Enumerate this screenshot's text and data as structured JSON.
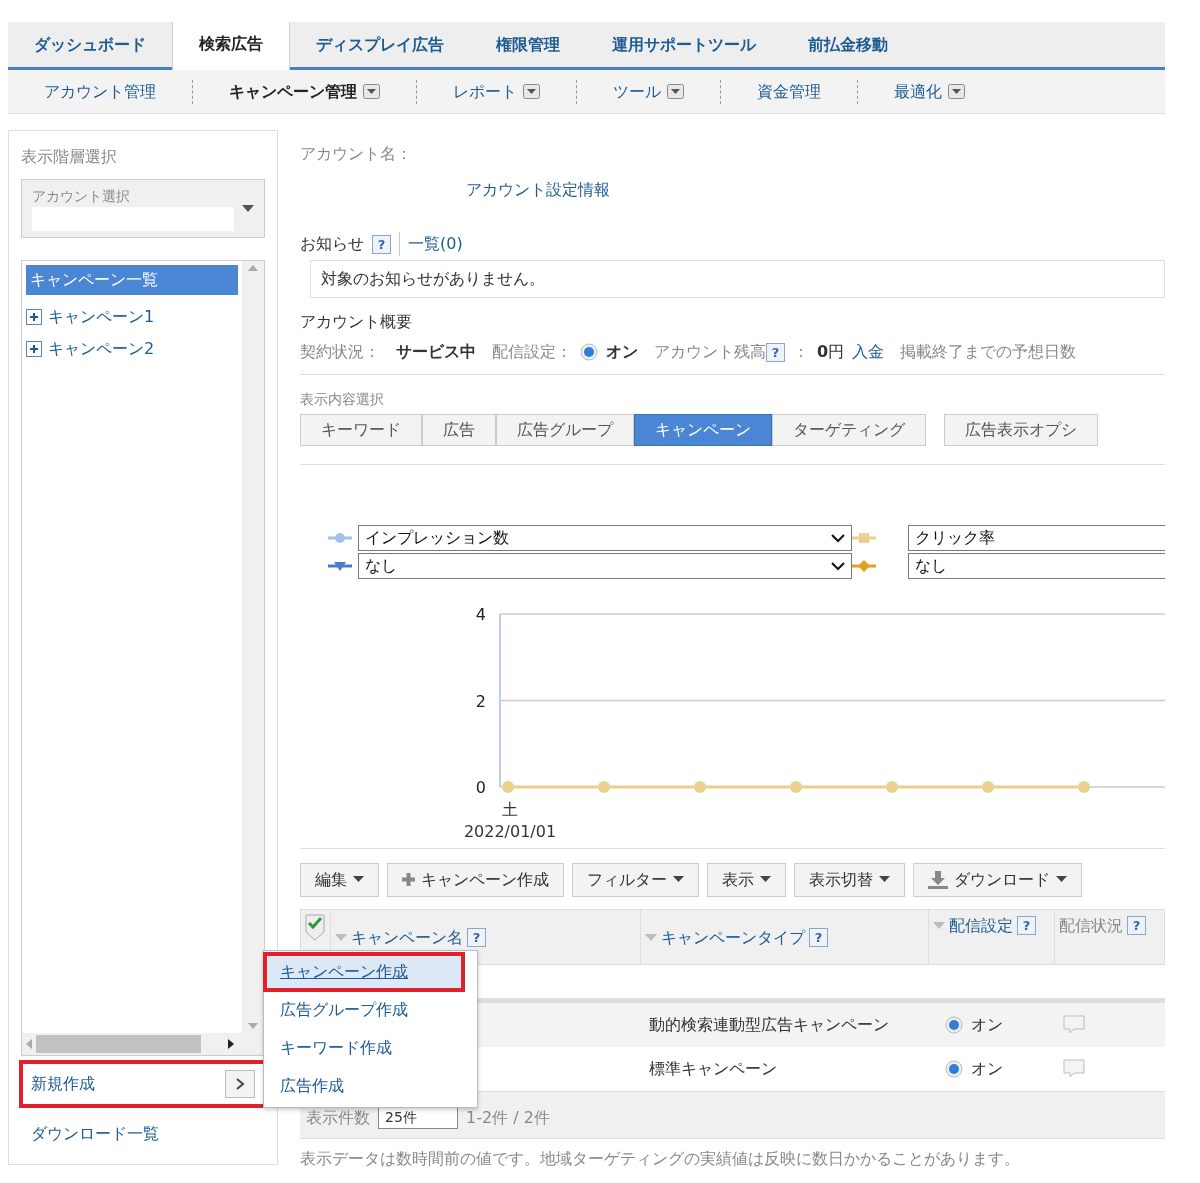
{
  "top_tabs": [
    {
      "label": "ダッシュボード",
      "selected": false
    },
    {
      "label": "検索広告",
      "selected": true
    },
    {
      "label": "ディスプレイ広告",
      "selected": false
    },
    {
      "label": "権限管理",
      "selected": false
    },
    {
      "label": "運用サポートツール",
      "selected": false
    },
    {
      "label": "前払金移動",
      "selected": false
    }
  ],
  "sub_nav": [
    {
      "label": "アカウント管理",
      "selected": false,
      "has_menu": false
    },
    {
      "label": "キャンペーン管理",
      "selected": true,
      "has_menu": true
    },
    {
      "label": "レポート",
      "selected": false,
      "has_menu": true
    },
    {
      "label": "ツール",
      "selected": false,
      "has_menu": true
    },
    {
      "label": "資金管理",
      "selected": false,
      "has_menu": false
    },
    {
      "label": "最適化",
      "selected": false,
      "has_menu": true
    }
  ],
  "sidebar": {
    "title": "表示階層選択",
    "account_select": {
      "label": "アカウント選択"
    },
    "tree": {
      "header": "キャンペーン一覧",
      "items": [
        {
          "label": "キャンペーン1",
          "expanded": false
        },
        {
          "label": "キャンペーン2",
          "expanded": false
        }
      ]
    },
    "actions": [
      {
        "label": "新規作成",
        "kind": "submenu",
        "highlighted": true
      },
      {
        "label": "ダウンロード一覧",
        "kind": "link",
        "highlighted": false
      }
    ]
  },
  "account": {
    "name_label": "アカウント名：",
    "settings_link": "アカウント設定情報"
  },
  "notices": {
    "title": "お知らせ",
    "help": "?",
    "list_link": "一覧(0)",
    "message": "対象のお知らせがありません。"
  },
  "overview": {
    "title": "アカウント概要",
    "contract_label": "契約状況：",
    "contract_value": "サービス中",
    "delivery_label": "配信設定：",
    "delivery_on": true,
    "delivery_value": "オン",
    "balance_label": "アカウント残高",
    "balance_help": "?",
    "balance_colon": "：",
    "balance_value": "**0**円",
    "deposit_link": "入金",
    "days_label": "掲載終了までの予想日数"
  },
  "view_select": {
    "label": "表示内容選択",
    "tabs": [
      {
        "label": "キーワード",
        "selected": false
      },
      {
        "label": "広告",
        "selected": false
      },
      {
        "label": "広告グループ",
        "selected": false
      },
      {
        "label": "キャンペーン",
        "selected": true
      },
      {
        "label": "ターゲティング",
        "selected": false
      },
      {
        "label": "広告表示オプシ",
        "selected": false
      }
    ]
  },
  "chart": {
    "metrics": [
      {
        "value": "インプレッション数",
        "color": "#a3c0e8"
      },
      {
        "value": "クリック率",
        "color": "#ebd08e"
      },
      {
        "value": "なし",
        "color": "#4a7fc8"
      },
      {
        "value": "なし",
        "color": "#e0a020"
      }
    ],
    "x_labels": [
      "土",
      "2022/01/01"
    ],
    "chart_data": {
      "type": "line",
      "ylim": [
        0,
        4
      ],
      "yticks": [
        {
          "value": 0,
          "label": "0"
        },
        {
          "value": 2,
          "label": "2"
        },
        {
          "value": 4,
          "label": "4"
        }
      ],
      "series": [
        {
          "color": "#ebd08e",
          "marker": "circle",
          "values": [
            0,
            0,
            0,
            0,
            0,
            0,
            0
          ]
        }
      ]
    }
  },
  "toolbar": [
    {
      "label": "編集",
      "caret": true
    },
    {
      "label": "キャンペーン作成",
      "caret": false
    },
    {
      "label": "フィルター",
      "caret": true
    },
    {
      "label": "表示",
      "caret": true
    },
    {
      "label": "表示切替",
      "caret": true
    },
    {
      "label": "ダウンロード",
      "caret": true
    }
  ],
  "table": {
    "select_all_checked": true,
    "columns": [
      {
        "label": "キャンペーン名",
        "help": "?",
        "sortable": true,
        "link": true
      },
      {
        "label": "キャンペーンタイプ",
        "help": "?",
        "sortable": true,
        "link": true
      },
      {
        "label": "配信設定",
        "help": "?",
        "sortable": true,
        "link": true
      },
      {
        "label": "配信状況",
        "help": "?",
        "sortable": false,
        "link": false
      }
    ],
    "rows": [
      {
        "type": "動的検索連動型広告キャンペーン",
        "delivery_on": true,
        "delivery": "オン"
      },
      {
        "type": "標準キャンペーン",
        "delivery_on": true,
        "delivery": "オン"
      }
    ]
  },
  "pager": {
    "label": "表示件数",
    "per_page": "25件",
    "range": "1-2件 / 2件"
  },
  "note": "表示データは数時間前の値です。地域ターゲティングの実績値は反映に数日かかることがあります。",
  "context_menu": {
    "items": [
      {
        "label": "キャンペーン作成",
        "selected": true
      },
      {
        "label": "広告グループ作成",
        "selected": false
      },
      {
        "label": "キーワード作成",
        "selected": false
      },
      {
        "label": "広告作成",
        "selected": false
      }
    ]
  }
}
